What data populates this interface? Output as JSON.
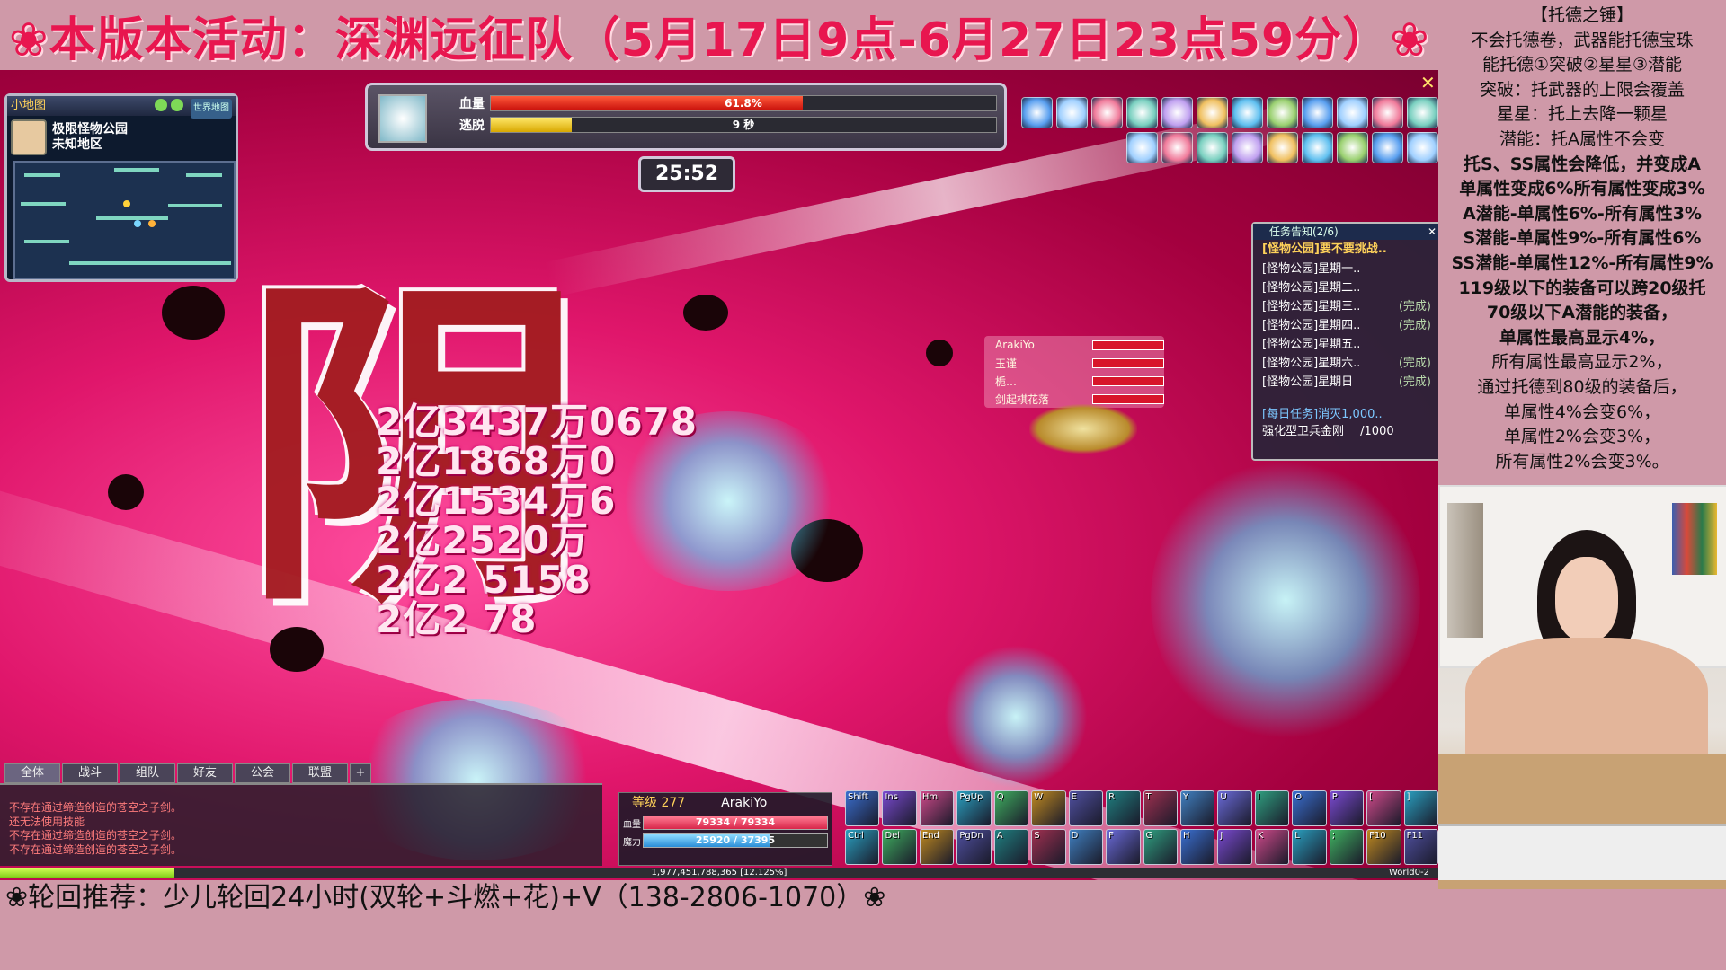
{
  "banner": {
    "text": "❀本版本活动：深渊远征队（5月17日9点-6月27日23点59分）❀"
  },
  "info_panel": {
    "lines": [
      "【托德之锤】",
      "不会托德卷，武器能托德宝珠",
      "能托德①突破②星星③潜能",
      "突破：托武器的上限会覆盖",
      "星星：托上去降一颗星",
      "潜能：托A属性不会变",
      "托S、SS属性会降低，并变成A",
      "单属性变成6%所有属性变成3%",
      "A潜能-单属性6%-所有属性3%",
      "S潜能-单属性9%-所有属性6%",
      "SS潜能-单属性12%-所有属性9%",
      "119级以下的装备可以跨20级托",
      "70级以下A潜能的装备，",
      "单属性最高显示4%，",
      "所有属性最高显示2%，",
      "通过托德到80级的装备后，",
      "单属性4%会变6%，",
      "单属性2%会变3%，",
      "所有属性2%会变3%。"
    ]
  },
  "minimap": {
    "header": "小地图",
    "tag": "世界地图",
    "map_name": "极限怪物公园",
    "region": "未知地区"
  },
  "boss": {
    "hp_label": "血量",
    "hp_value": "61.8%",
    "hp_fraction": 0.618,
    "escape_label": "逃脱",
    "escape_value": "9 秒",
    "escape_fraction": 0.16,
    "timer": "25:52",
    "close_icon": "close-icon"
  },
  "big_glyph": {
    "text": "阴"
  },
  "damage_numbers": [
    "2亿3437万0678",
    "2亿1868万0",
    "2亿1534万6",
    "2亿2520万",
    "2亿2    5158",
    "2亿2      78"
  ],
  "quest": {
    "header": "任务告知(2/6)",
    "title": "[怪物公园]要不要挑战..",
    "items": [
      {
        "name": "[怪物公园]星期一..",
        "status": ""
      },
      {
        "name": "[怪物公园]星期二..",
        "status": ""
      },
      {
        "name": "[怪物公园]星期三..",
        "status": "(完成)"
      },
      {
        "name": "[怪物公园]星期四..",
        "status": "(完成)"
      },
      {
        "name": "[怪物公园]星期五..",
        "status": ""
      },
      {
        "name": "[怪物公园]星期六..",
        "status": "(完成)"
      },
      {
        "name": "[怪物公园]星期日",
        "status": "(完成)"
      }
    ],
    "daily": "[每日任务]消灭1,000..",
    "daily_sub": "强化型卫兵金刚",
    "daily_progress": "/1000"
  },
  "party": {
    "members": [
      {
        "name": "ArakiYo",
        "hp_fraction": 1.0
      },
      {
        "name": "玉谨",
        "hp_fraction": 1.0
      },
      {
        "name": "栀…",
        "hp_fraction": 1.0
      },
      {
        "name": "剑起棋花落",
        "hp_fraction": 1.0
      }
    ]
  },
  "chat": {
    "tabs": [
      "全体",
      "战斗",
      "组队",
      "好友",
      "公会",
      "联盟",
      "+"
    ],
    "lines": [
      "不存在通过缔造创造的苍空之子剑。",
      "还无法使用技能",
      "不存在通过缔造创造的苍空之子剑。",
      "不存在通过缔造创造的苍空之子剑。"
    ]
  },
  "status": {
    "level_label": "等级 277",
    "name": "ArakiYo",
    "hp_label": "血量",
    "hp_text": "79334 / 79334",
    "hp_fraction": 1.0,
    "mp_label": "魔力",
    "mp_text": "25920 / 37395",
    "mp_fraction": 0.69
  },
  "hotkeys": {
    "row1": [
      "Shift",
      "Ins",
      "Hm",
      "PgUp",
      "Q",
      "W",
      "E",
      "R",
      "T",
      "Y",
      "U",
      "I",
      "O",
      "P",
      "[",
      "]"
    ],
    "row2": [
      "Ctrl",
      "Del",
      "End",
      "PgDn",
      "A",
      "S",
      "D",
      "F",
      "G",
      "H",
      "J",
      "K",
      "L",
      ";",
      "F10",
      "F11"
    ]
  },
  "exp": {
    "text": "1,977,451,788,365 [12.125%]",
    "fraction": 0.1213,
    "world": "World0-2"
  },
  "bottom_text": "❀轮回推荐：少儿轮回24小时(双轮+斗燃+花)+V（138-2806-1070）❀",
  "colors": {
    "banner": "#e8164f",
    "boss_hp": "#e02020",
    "boss_escape": "#f6d21a",
    "player_hp": "#f04a6a",
    "player_mp": "#4ab8f0",
    "exp": "#9ee13a"
  }
}
